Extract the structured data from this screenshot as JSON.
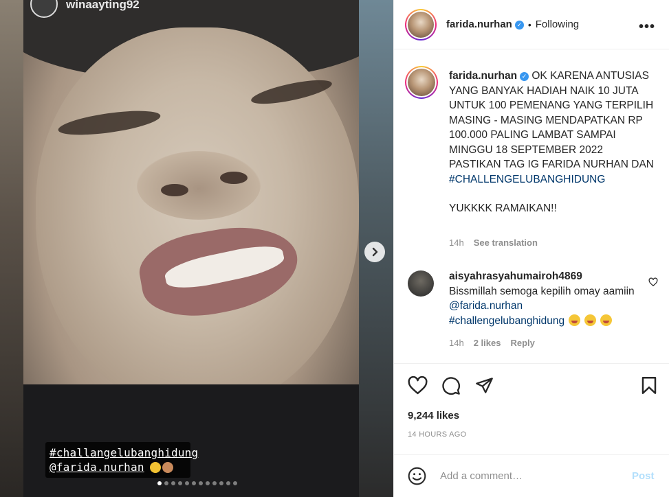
{
  "media": {
    "poster_username": "winaayting92",
    "sticker_line1": "#challangelubanghidung",
    "sticker_line2": "@farida.nurhan",
    "carousel_total": 12,
    "carousel_active_index": 0
  },
  "header": {
    "username": "farida.nurhan",
    "separator": "•",
    "follow_status": "Following",
    "more": "•••"
  },
  "caption": {
    "username": "farida.nurhan",
    "text": "OK KARENA ANTUSIAS YANG BANYAK HADIAH NAIK 10 JUTA UNTUK 100 PEMENANG YANG TERPILIH MASING - MASING MENDAPATKAN RP 100.000 PALING LAMBAT SAMPAI MINGGU 18 SEPTEMBER 2022 PASTIKAN TAG IG FARIDA NURHAN DAN",
    "hashtag": "#CHALLENGELUBANGHIDUNG",
    "closing": "YUKKKK RAMAIKAN!!",
    "time": "14h",
    "see_translation": "See translation"
  },
  "comment": {
    "username": "aisyahrasyahumairoh4869",
    "text": "Bissmillah semoga kepilih omay aamiin",
    "mention": "@farida.nurhan",
    "hashtag": "#challengelubanghidung",
    "time": "14h",
    "likes": "2 likes",
    "reply": "Reply"
  },
  "stats": {
    "likes": "9,244 likes",
    "timestamp": "14 HOURS AGO"
  },
  "comment_bar": {
    "placeholder": "Add a comment…",
    "post": "Post"
  },
  "colors": {
    "link": "#00376b",
    "verified": "#3897f0",
    "muted": "#8e8e8e",
    "post_disabled": "#b2dffc"
  }
}
